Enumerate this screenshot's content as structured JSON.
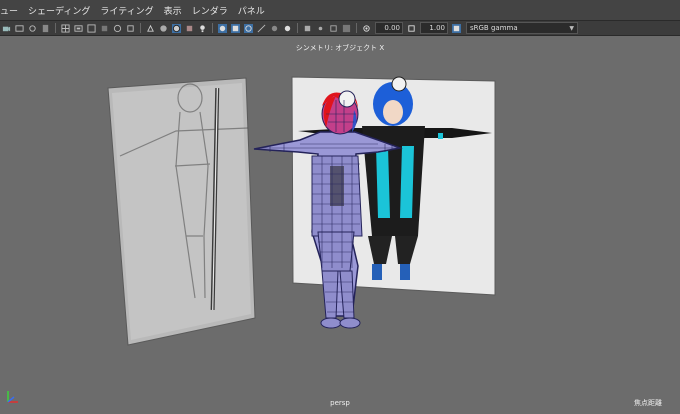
{
  "menu": {
    "items": [
      "ュー",
      "シェーディング",
      "ライティング",
      "表示",
      "レンダラ",
      "パネル"
    ]
  },
  "toolbar": {
    "exposure_value": "0.00",
    "gamma_value": "1.00",
    "color_space": "sRGB gamma"
  },
  "viewport": {
    "top_label": "シンメトリ: オブジェクト X",
    "camera_name": "persp",
    "corner_label": "焦点距離"
  },
  "colors": {
    "menu_bg": "#444444",
    "toolbar_bg": "#3c3c3c",
    "viewport_bg": "#6c6c6c",
    "wireframe": "#24235a",
    "mesh_fill": "#9a98d6",
    "hair_red": "#e0141c",
    "hair_blue": "#1d5fd8",
    "accent_cyan": "#1bc4d8"
  },
  "icons": [
    "move-icon",
    "rotate-icon",
    "scale-icon",
    "grid-icon",
    "camera-icon",
    "wireframe-icon",
    "shaded-icon",
    "light-icon",
    "film-icon",
    "exposure-icon",
    "gamma-icon"
  ]
}
